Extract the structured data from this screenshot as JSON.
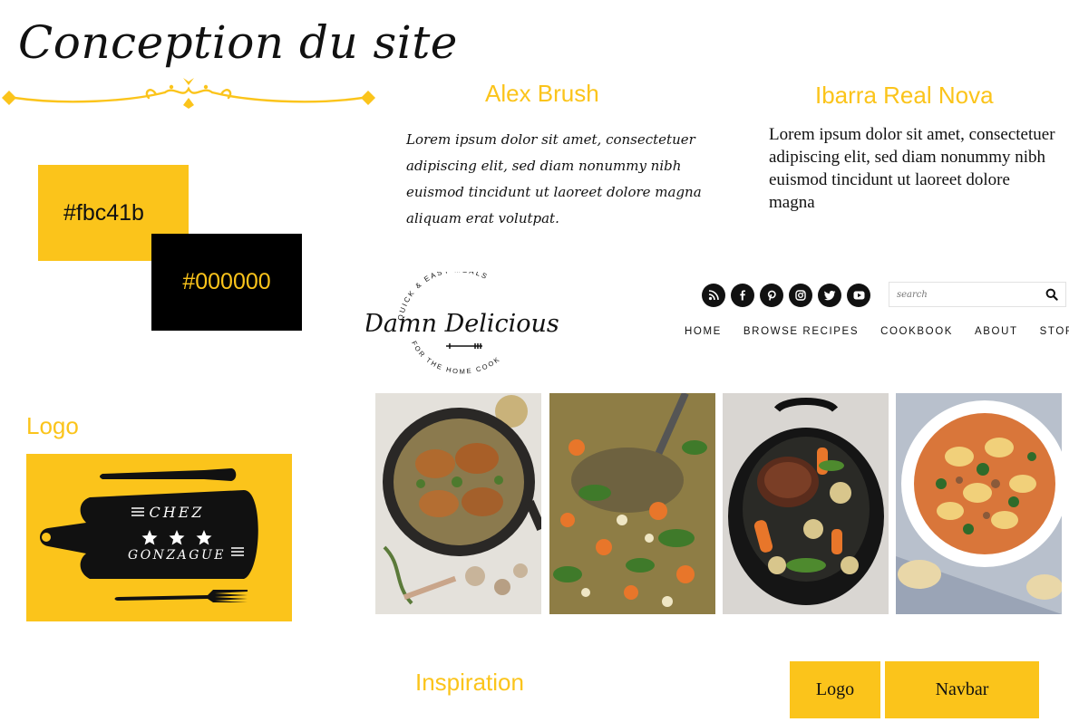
{
  "title": "Conception du site",
  "fonts": {
    "alex": {
      "name": "Alex Brush",
      "sample": "Lorem ipsum dolor sit amet, consectetuer adipiscing elit, sed diam nonummy nibh euismod tincidunt ut laoreet dolore magna aliquam erat volutpat."
    },
    "ibarra": {
      "name": "Ibarra Real Nova",
      "sample": "Lorem ipsum dolor sit amet, consectetuer adipiscing elit, sed diam nonummy nibh euismod tincidunt ut laoreet dolore magna"
    }
  },
  "colors": {
    "primary": "#fbc41b",
    "secondary": "#000000",
    "primary_label": "#fbc41b",
    "secondary_label": "#000000"
  },
  "logo": {
    "heading": "Logo",
    "line1": "CHEZ",
    "line2": "GONZAGUE"
  },
  "inspiration": {
    "heading": "Inspiration",
    "site_logo": {
      "top_arc": "QUICK & EASY MEALS",
      "name": "Damn Delicious",
      "bottom_arc": "FOR THE HOME COOK"
    },
    "social_icons": [
      "rss-icon",
      "facebook-icon",
      "pinterest-icon",
      "instagram-icon",
      "twitter-icon",
      "youtube-icon"
    ],
    "search_placeholder": "search",
    "nav": [
      "HOME",
      "BROWSE RECIPES",
      "COOKBOOK",
      "ABOUT",
      "STORE"
    ],
    "photos": [
      "chicken-skillet-photo",
      "vegetable-soup-photo",
      "slow-cooker-roast-photo",
      "tortellini-soup-photo"
    ]
  },
  "layout_buttons": {
    "logo": "Logo",
    "navbar": "Navbar"
  }
}
